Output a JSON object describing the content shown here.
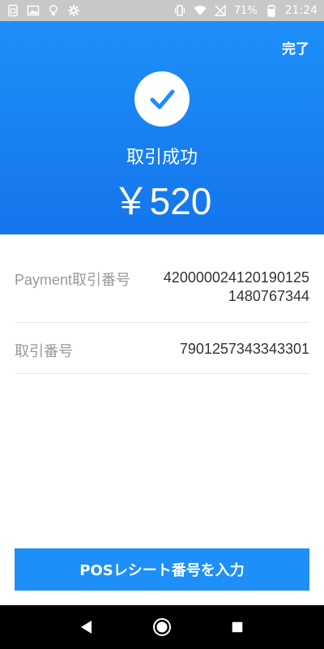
{
  "status_bar": {
    "battery_percent": "71%",
    "time": "21:24",
    "icons_left": [
      "sim-card-icon",
      "image-icon",
      "lightbulb-icon",
      "settings-icon"
    ],
    "icons_right": [
      "vibrate-icon",
      "wifi-icon",
      "no-signal-icon",
      "battery-icon"
    ]
  },
  "header": {
    "done_label": "完了",
    "title": "取引成功",
    "amount": "￥520",
    "background_color": "#1e8ff9"
  },
  "details": {
    "rows": [
      {
        "label": "Payment取引番号",
        "value": "4200000241201901251480767344"
      },
      {
        "label": "取引番号",
        "value": "7901257343343301"
      }
    ]
  },
  "pos_button": {
    "label": "POSレシート番号を入力"
  },
  "nav_bar": {
    "icons": [
      "back-icon",
      "home-icon",
      "recents-icon"
    ]
  }
}
